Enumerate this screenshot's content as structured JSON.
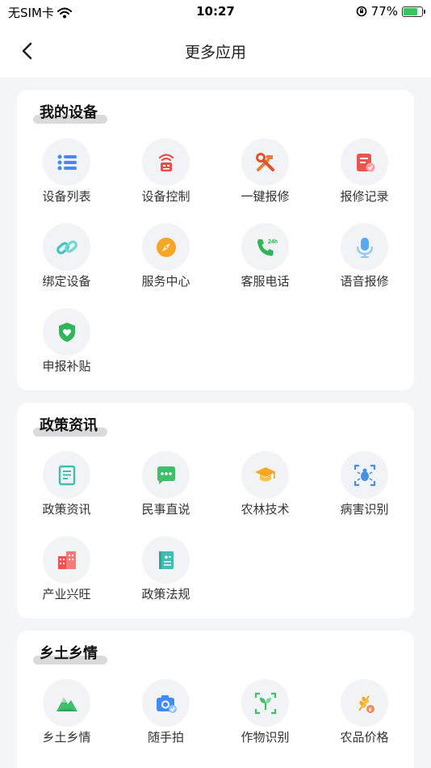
{
  "status": {
    "carrier": "无SIM卡",
    "time": "10:27",
    "battery": "77%",
    "battery_level": 0.77
  },
  "nav": {
    "title": "更多应用"
  },
  "sections": [
    {
      "title": "我的设备",
      "items": [
        {
          "label": "设备列表",
          "icon": "list-icon"
        },
        {
          "label": "设备控制",
          "icon": "remote-control-icon"
        },
        {
          "label": "一键报修",
          "icon": "wrench-hammer-icon"
        },
        {
          "label": "报修记录",
          "icon": "repair-record-icon"
        },
        {
          "label": "绑定设备",
          "icon": "link-icon"
        },
        {
          "label": "服务中心",
          "icon": "compass-icon"
        },
        {
          "label": "客服电话",
          "icon": "phone-24h-icon"
        },
        {
          "label": "语音报修",
          "icon": "microphone-icon"
        },
        {
          "label": "申报补贴",
          "icon": "shield-heart-icon"
        }
      ]
    },
    {
      "title": "政策资讯",
      "items": [
        {
          "label": "政策资讯",
          "icon": "document-icon"
        },
        {
          "label": "民事直说",
          "icon": "chat-icon"
        },
        {
          "label": "农林技术",
          "icon": "graduation-cap-icon"
        },
        {
          "label": "病害识别",
          "icon": "bug-scan-icon"
        },
        {
          "label": "产业兴旺",
          "icon": "buildings-icon"
        },
        {
          "label": "政策法规",
          "icon": "law-book-icon"
        }
      ]
    },
    {
      "title": "乡土乡情",
      "items": [
        {
          "label": "乡土乡情",
          "icon": "mountain-icon"
        },
        {
          "label": "随手拍",
          "icon": "camera-icon"
        },
        {
          "label": "作物识别",
          "icon": "plant-scan-icon"
        },
        {
          "label": "农品价格",
          "icon": "wheat-price-icon"
        }
      ]
    }
  ]
}
